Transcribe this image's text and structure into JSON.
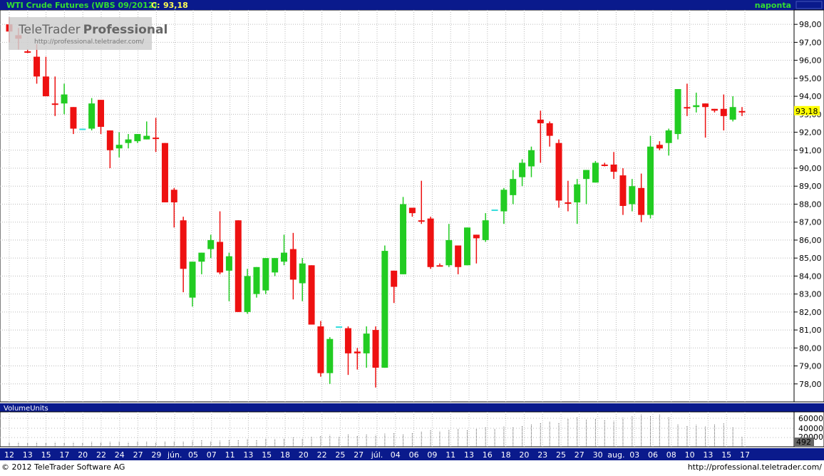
{
  "header": {
    "instrument": "WTI Crude Futures (WBS 09/2012)",
    "close_label": "C:",
    "close_value": "93,18",
    "timeframe": "naponta"
  },
  "watermark": {
    "brand_regular": "TeleTrader",
    "brand_bold": "Professional",
    "url": "http://professional.teletrader.com/"
  },
  "volume_panel": {
    "title": "VolumeUnits",
    "axis_labels": [
      "60000",
      "40000",
      "20000"
    ],
    "last_value": "492"
  },
  "footer": {
    "copyright": "© 2012 TeleTrader Software AG",
    "url": "http://professional.teletrader.com/"
  },
  "colors": {
    "up": "#22cc22",
    "down": "#ee1111",
    "doji": "#33dddd",
    "header_bg": "#0a1a8c",
    "header_text": "#33dd33",
    "grid": "#bbbbbb",
    "last_price_bg": "#ffff00"
  },
  "chart_data": {
    "type": "candlestick",
    "title": "WTI Crude Futures (WBS 09/2012)",
    "ylim": [
      77.0,
      98.8
    ],
    "y_ticks": [
      "98,00",
      "97,00",
      "96,00",
      "95,00",
      "94,00",
      "93,00",
      "92,00",
      "91,00",
      "90,00",
      "89,00",
      "88,00",
      "87,00",
      "86,00",
      "85,00",
      "84,00",
      "83,00",
      "82,00",
      "81,00",
      "80,00",
      "79,00",
      "78,00"
    ],
    "x_ticks": [
      "12",
      "13",
      "15",
      "17",
      "20",
      "22",
      "24",
      "27",
      "29",
      "jún.",
      "05",
      "07",
      "11",
      "13",
      "15",
      "18",
      "20",
      "22",
      "25",
      "27",
      "júl.",
      "04",
      "06",
      "09",
      "11",
      "13",
      "16",
      "18",
      "20",
      "23",
      "25",
      "27",
      "30",
      "aug.",
      "03",
      "06",
      "08",
      "10",
      "13",
      "15",
      "17"
    ],
    "last_price": 93.18,
    "ohlc": [
      [
        98.0,
        98.4,
        97.0,
        97.6
      ],
      [
        97.4,
        97.8,
        96.6,
        97.2
      ],
      [
        96.5,
        96.6,
        96.4,
        96.5
      ],
      [
        96.2,
        96.9,
        94.7,
        95.1
      ],
      [
        95.1,
        96.2,
        94.0,
        94.0
      ],
      [
        93.6,
        95.1,
        92.9,
        93.6
      ],
      [
        93.6,
        94.7,
        93.0,
        94.1
      ],
      [
        93.4,
        93.4,
        91.9,
        92.2
      ],
      [
        92.2,
        92.2,
        92.2,
        92.2
      ],
      [
        92.2,
        93.9,
        92.1,
        93.6
      ],
      [
        93.8,
        93.8,
        91.9,
        92.3
      ],
      [
        92.1,
        92.1,
        90.0,
        91.0
      ],
      [
        91.1,
        92.0,
        90.6,
        91.3
      ],
      [
        91.4,
        91.9,
        91.1,
        91.6
      ],
      [
        91.5,
        91.9,
        91.4,
        91.9
      ],
      [
        91.6,
        92.6,
        91.6,
        91.8
      ],
      [
        91.7,
        92.8,
        90.9,
        91.7
      ],
      [
        91.4,
        91.4,
        88.1,
        88.1
      ],
      [
        88.8,
        88.9,
        86.7,
        88.1
      ],
      [
        87.1,
        87.3,
        83.1,
        84.4
      ],
      [
        82.8,
        84.8,
        82.3,
        84.8
      ],
      [
        84.8,
        85.3,
        84.1,
        85.3
      ],
      [
        85.5,
        86.3,
        85.0,
        86.0
      ],
      [
        85.9,
        87.6,
        84.1,
        84.2
      ],
      [
        84.3,
        85.3,
        82.6,
        85.1
      ],
      [
        87.1,
        87.1,
        82.0,
        82.0
      ],
      [
        82.0,
        84.4,
        81.9,
        84.0
      ],
      [
        83.0,
        84.5,
        82.8,
        84.5
      ],
      [
        83.2,
        85.0,
        83.0,
        85.0
      ],
      [
        84.2,
        85.0,
        84.0,
        85.0
      ],
      [
        84.8,
        86.3,
        84.6,
        85.3
      ],
      [
        85.5,
        86.4,
        82.7,
        83.8
      ],
      [
        83.6,
        85.0,
        82.6,
        84.7
      ],
      [
        84.6,
        84.6,
        81.3,
        81.3
      ],
      [
        81.2,
        81.5,
        78.4,
        78.6
      ],
      [
        78.6,
        80.6,
        78.0,
        80.5
      ],
      [
        81.2,
        81.2,
        81.2,
        81.2
      ],
      [
        81.1,
        81.2,
        78.5,
        79.7
      ],
      [
        79.8,
        80.0,
        78.8,
        79.7
      ],
      [
        79.7,
        81.2,
        78.9,
        80.8
      ],
      [
        81.0,
        81.2,
        77.8,
        78.9
      ],
      [
        78.9,
        85.7,
        78.9,
        85.4
      ],
      [
        84.3,
        84.3,
        82.5,
        83.4
      ],
      [
        84.1,
        88.4,
        84.1,
        88.0
      ],
      [
        87.8,
        87.8,
        87.3,
        87.5
      ],
      [
        87.1,
        89.3,
        86.9,
        87.1
      ],
      [
        87.2,
        87.3,
        84.4,
        84.5
      ],
      [
        84.6,
        84.7,
        84.6,
        84.6
      ],
      [
        84.6,
        86.9,
        84.5,
        86.0
      ],
      [
        85.7,
        85.7,
        84.1,
        84.5
      ],
      [
        84.6,
        86.7,
        84.6,
        86.7
      ],
      [
        86.3,
        86.3,
        84.7,
        86.1
      ],
      [
        86.0,
        87.5,
        85.9,
        87.1
      ],
      [
        87.7,
        87.7,
        87.7,
        87.7
      ],
      [
        87.6,
        88.9,
        86.9,
        88.8
      ],
      [
        88.5,
        89.9,
        88.0,
        89.4
      ],
      [
        89.5,
        90.5,
        89.0,
        90.3
      ],
      [
        90.1,
        91.2,
        89.5,
        91.0
      ],
      [
        92.7,
        93.2,
        90.3,
        92.5
      ],
      [
        92.5,
        92.6,
        91.2,
        91.8
      ],
      [
        91.4,
        91.6,
        87.8,
        88.2
      ],
      [
        88.1,
        89.3,
        87.6,
        88.1
      ],
      [
        88.1,
        89.4,
        86.9,
        89.1
      ],
      [
        89.4,
        89.9,
        88.0,
        89.9
      ],
      [
        89.2,
        90.4,
        89.2,
        90.3
      ],
      [
        90.2,
        90.3,
        90.1,
        90.2
      ],
      [
        90.2,
        90.9,
        89.4,
        89.8
      ],
      [
        89.6,
        90.0,
        87.4,
        87.9
      ],
      [
        88.0,
        89.4,
        87.6,
        89.0
      ],
      [
        88.9,
        89.7,
        87.0,
        87.4
      ],
      [
        87.4,
        91.8,
        87.2,
        91.2
      ],
      [
        91.3,
        91.5,
        91.0,
        91.1
      ],
      [
        91.4,
        92.2,
        90.7,
        92.1
      ],
      [
        91.9,
        94.4,
        91.6,
        94.4
      ],
      [
        93.4,
        94.7,
        92.9,
        93.4
      ],
      [
        93.4,
        94.2,
        93.1,
        93.5
      ],
      [
        93.6,
        93.6,
        91.7,
        93.4
      ],
      [
        93.3,
        93.3,
        93.1,
        93.2
      ],
      [
        93.3,
        94.1,
        92.1,
        92.9
      ],
      [
        92.7,
        94.0,
        92.6,
        93.4
      ],
      [
        93.18,
        93.4,
        92.9,
        93.18
      ]
    ],
    "volume_ylim": [
      0,
      66000
    ],
    "volume": [
      9000,
      9000,
      8000,
      9000,
      8000,
      9000,
      8500,
      9000,
      8000,
      9500,
      9000,
      9500,
      10000,
      9000,
      10000,
      10000,
      9000,
      11000,
      10000,
      11000,
      12000,
      13000,
      11000,
      12000,
      14000,
      13000,
      15000,
      14000,
      16000,
      15000,
      17000,
      18000,
      16000,
      20000,
      22000,
      23000,
      20000,
      24000,
      22000,
      25000,
      23000,
      26000,
      27000,
      25000,
      28000,
      30000,
      33000,
      31000,
      34000,
      35000,
      33000,
      36000,
      38000,
      35000,
      40000,
      38000,
      42000,
      45000,
      47000,
      50000,
      48000,
      55000,
      58000,
      54000,
      56000,
      52000,
      51000,
      57000,
      60000,
      63000,
      61000,
      64000,
      58000,
      45000,
      42000,
      43000,
      40000,
      44000,
      46000,
      38000,
      20000
    ]
  }
}
